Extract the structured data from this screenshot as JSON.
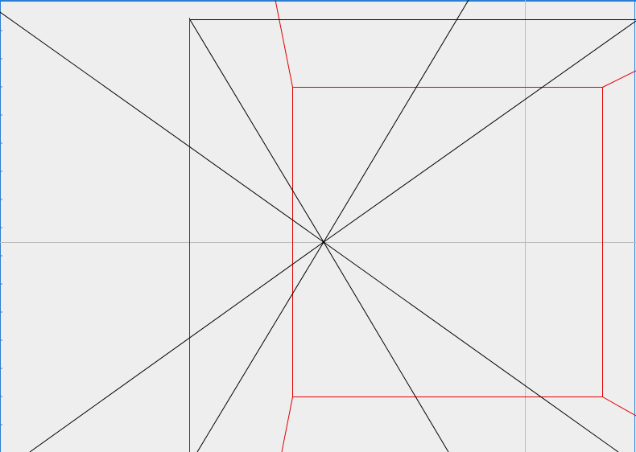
{
  "canvas": {
    "background_color": "#eeeeee",
    "frame_color": "#2a7fd4",
    "guide_color": "#bcbcbc",
    "wire_color": "#e00000",
    "construction_color": "#000000"
  }
}
